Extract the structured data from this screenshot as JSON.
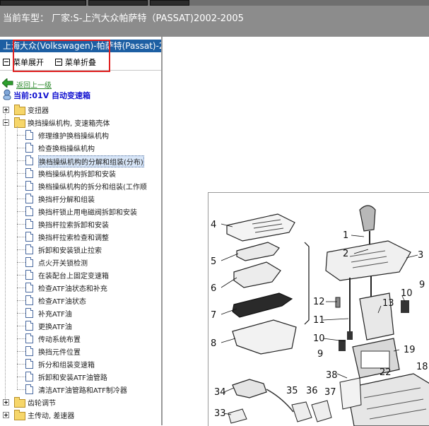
{
  "header": {
    "label": "当前车型：  厂家:S-上汽大众帕萨特（PASSAT)2002-2005"
  },
  "panel": {
    "title": "上海大众(Volkswagen)-帕萨特(Passat)-2",
    "expand_all": "菜单展开",
    "collapse_all": "菜单折叠",
    "back_link": "返回上一级",
    "current": "当前:01V 自动变速箱"
  },
  "tree": {
    "top_folders": [
      "变扭器",
      "换挡操纵机构, 变速箱壳体"
    ],
    "items": [
      "修理维护换档操纵机构",
      "检查换档操纵机构",
      "换档操纵机构的分解和组装(分布)",
      "换档操纵机构拆卸和安装",
      "换档操纵机构的拆分和组装(工作顺",
      "换挡杆分解和组装",
      "换挡杆锁止用电磁阀拆卸和安装",
      "换挡杆拉索拆卸和安装",
      "换挡杆拉索检查和调整",
      "拆卸和安装锁止拉索",
      "点火开关锁检测",
      "在装配台上固定变速箱",
      "检查ATF油状态和补充",
      "检查ATF油状态",
      "补充ATF油",
      "更换ATF油",
      "传动系统布置",
      "换挡元件位置",
      "拆分和组装变速箱",
      "拆卸和安装ATF油管路",
      "清洁ATF油管路和ATF制冷器"
    ],
    "bottom_folders": [
      "齿轮调节",
      "主传动, 差速器"
    ]
  },
  "diagram": {
    "callouts": [
      "1",
      "2",
      "3",
      "4",
      "5",
      "6",
      "7",
      "8",
      "9",
      "10",
      "11",
      "12",
      "13",
      "19",
      "22",
      "33",
      "34",
      "35",
      "36",
      "37",
      "38",
      "10",
      "9",
      "18"
    ]
  }
}
